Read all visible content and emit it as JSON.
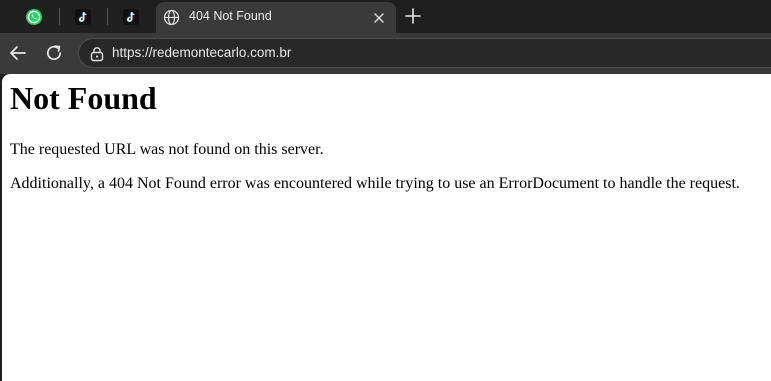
{
  "tabs": {
    "pinned": [
      {
        "icon": "whatsapp-icon",
        "color": "#25d366"
      },
      {
        "icon": "tiktok-icon",
        "color": "#ffffff"
      },
      {
        "icon": "tiktok-icon",
        "color": "#ffffff"
      }
    ],
    "active": {
      "title": "404 Not Found",
      "icon": "globe-icon"
    },
    "new_tab_icon": "plus-icon"
  },
  "toolbar": {
    "back_icon": "back-arrow-icon",
    "reload_icon": "reload-icon",
    "site_info_icon": "site-info-icon",
    "url": "https://redemontecarlo.com.br"
  },
  "page": {
    "heading": "Not Found",
    "paragraphs": [
      "The requested URL was not found on this server.",
      "Additionally, a 404 Not Found error was encountered while trying to use an ErrorDocument to handle the request."
    ]
  },
  "colors": {
    "chrome_dark": "#1f1f1f",
    "toolbar": "#3a3a3a",
    "page_bg": "#ffffff"
  }
}
